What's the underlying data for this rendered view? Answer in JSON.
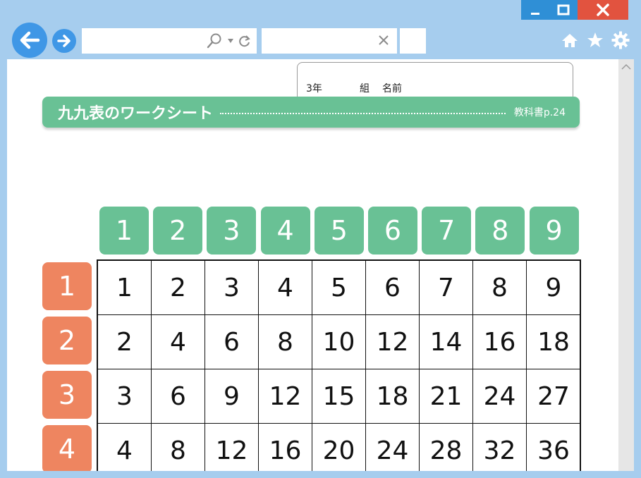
{
  "browser": {
    "address_value": "",
    "tab_value": "",
    "icons": [
      "back-arrow-icon",
      "forward-arrow-icon",
      "search-icon",
      "dropdown-icon",
      "refresh-icon",
      "close-icon",
      "home-icon",
      "star-icon",
      "gear-icon"
    ]
  },
  "worksheet": {
    "grade": "3年",
    "class_label": "組",
    "name_label": "名前",
    "title": "九九表のワークシート",
    "reference": "教科書p.24",
    "column_headers": [
      "1",
      "2",
      "3",
      "4",
      "5",
      "6",
      "7",
      "8",
      "9"
    ],
    "row_headers": [
      "1",
      "2",
      "3",
      "4"
    ],
    "rows": [
      [
        "1",
        "2",
        "3",
        "4",
        "5",
        "6",
        "7",
        "8",
        "9"
      ],
      [
        "2",
        "4",
        "6",
        "8",
        "10",
        "12",
        "14",
        "16",
        "18"
      ],
      [
        "3",
        "6",
        "9",
        "12",
        "15",
        "18",
        "21",
        "24",
        "27"
      ],
      [
        "4",
        "8",
        "12",
        "16",
        "20",
        "24",
        "28",
        "32",
        "36"
      ]
    ]
  },
  "colors": {
    "column_header": "#69c195",
    "row_header": "#ee8560",
    "chrome": "#a6cdee",
    "nav_button": "#3f97e6",
    "close_button": "#e2533f"
  }
}
